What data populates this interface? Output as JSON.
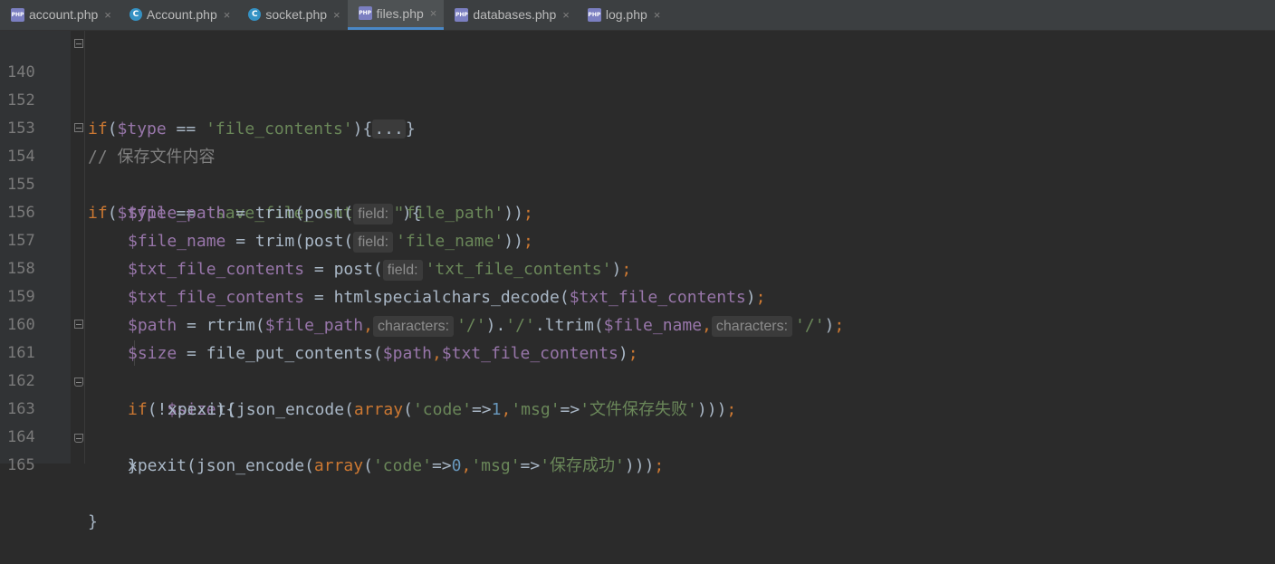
{
  "tabs": [
    {
      "label": "account.php",
      "icon": "php-file-icon"
    },
    {
      "label": "Account.php",
      "icon": "php-class-icon"
    },
    {
      "label": "socket.php",
      "icon": "php-class-icon"
    },
    {
      "label": "files.php",
      "icon": "php-file-icon",
      "active": true
    },
    {
      "label": "databases.php",
      "icon": "php-file-icon"
    },
    {
      "label": "log.php",
      "icon": "php-file-icon"
    }
  ],
  "icons": {
    "php": "PHP",
    "class": "C",
    "close": "×"
  },
  "hint_labels": {
    "field": "field:",
    "characters": "characters:"
  },
  "lines": {
    "l140": {
      "n": "140",
      "a": "if",
      "b": "(",
      "c": "$type",
      "d": " == ",
      "e": "'file_contents'",
      "f": "){",
      "g": "...",
      "h": "}"
    },
    "l152": {
      "n": "152"
    },
    "l153": {
      "n": "153",
      "a": "// 保存文件内容"
    },
    "l154": {
      "n": "154",
      "a": "if",
      "b": "(",
      "c": "$type",
      "d": " == ",
      "e": "'save_file_contents'",
      "f": "){"
    },
    "l155": {
      "n": "155",
      "a": "$file_path",
      "b": " = trim(post(",
      "c": "'file_path'",
      "d": "))",
      "e": ";"
    },
    "l156": {
      "n": "156",
      "a": "$file_name",
      "b": " = trim(post(",
      "c": "'file_name'",
      "d": "))",
      "e": ";"
    },
    "l157": {
      "n": "157",
      "a": "$txt_file_contents",
      "b": " = post(",
      "c": "'txt_file_contents'",
      "d": ")",
      "e": ";"
    },
    "l158": {
      "n": "158",
      "a": "$txt_file_contents",
      "b": " = htmlspecialchars_decode(",
      "c": "$txt_file_contents",
      "d": ")",
      "e": ";"
    },
    "l159": {
      "n": "159",
      "a": "$path",
      "b": " = rtrim(",
      "c": "$file_path",
      "d": ",",
      "e": "'/'",
      "f": ").",
      "g": "'/'",
      "h": ".ltrim(",
      "i": "$file_name",
      "j": ",",
      "k": "'/'",
      "l": ")",
      "m": ";"
    },
    "l160": {
      "n": "160",
      "a": "$size",
      "b": " = file_put_contents(",
      "c": "$path",
      "d": ",",
      "e": "$txt_file_contents",
      "f": ")",
      "g": ";"
    },
    "l161": {
      "n": "161",
      "a": "if",
      "b": "(!",
      "c": "$size",
      "d": "){"
    },
    "l162": {
      "n": "162",
      "a": "xpexit(json_encode(",
      "b": "array",
      "c": "(",
      "d": "'code'",
      "e": "=>",
      "f": "1",
      "g": ",",
      "h": "'msg'",
      "i": "=>",
      "j": "'文件保存失败'",
      "k": ")))",
      "l": ";"
    },
    "l163": {
      "n": "163",
      "a": "}"
    },
    "l164": {
      "n": "164",
      "a": "xpexit(json_encode(",
      "b": "array",
      "c": "(",
      "d": "'code'",
      "e": "=>",
      "f": "0",
      "g": ",",
      "h": "'msg'",
      "i": "=>",
      "j": "'保存成功'",
      "k": ")))",
      "l": ";"
    },
    "l165": {
      "n": "165",
      "a": "}"
    }
  },
  "colors": {
    "background": "#2b2b2b",
    "keyword": "#cc7832",
    "variable": "#9876aa",
    "string": "#6a8759",
    "number": "#6897bb",
    "comment": "#808080",
    "default_text": "#a9b7c6",
    "active_tab_accent": "#4a88c7"
  }
}
